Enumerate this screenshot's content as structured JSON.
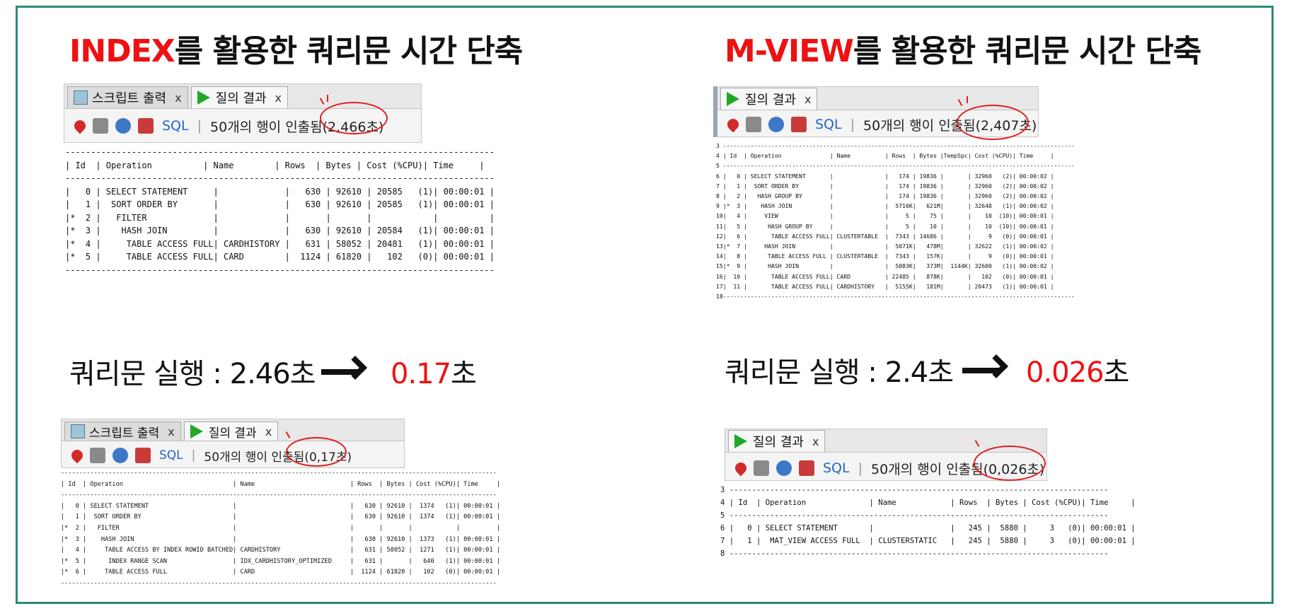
{
  "left": {
    "heading_red": "INDEX",
    "heading_rest": "를 활용한 쿼리문 시간 단축",
    "compare_label": "쿼리문 실행 : 2.46초",
    "compare_result_red": "0.17",
    "compare_result_unit": "초",
    "before_panel": {
      "tabs": [
        {
          "label": "스크립트 출력",
          "close": "x",
          "icon": "script-icon"
        },
        {
          "label": "질의 결과",
          "close": "x",
          "icon": "play-icon"
        }
      ],
      "toolbar_sql": "SQL",
      "status": "50개의 행이 인출됨(2,466초)"
    },
    "before_plan": "------------------------------------------------------------------------------------\n| Id  | Operation          | Name        | Rows  | Bytes | Cost (%CPU)| Time     |\n------------------------------------------------------------------------------------\n|   0 | SELECT STATEMENT     |             |   630 | 92610 | 20585   (1)| 00:00:01 |\n|   1 |  SORT ORDER BY       |             |   630 | 92610 | 20585   (1)| 00:00:01 |\n|*  2 |   FILTER             |             |       |       |            |          |\n|*  3 |    HASH JOIN         |             |   630 | 92610 | 20584   (1)| 00:00:01 |\n|*  4 |     TABLE ACCESS FULL| CARDHISTORY |   631 | 58052 | 20481   (1)| 00:00:01 |\n|*  5 |     TABLE ACCESS FULL| CARD        |  1124 | 61820 |   102   (0)| 00:00:01 |\n------------------------------------------------------------------------------------",
    "after_panel": {
      "tabs": [
        {
          "label": "스크립트 출력",
          "close": "x",
          "icon": "script-icon"
        },
        {
          "label": "질의 결과",
          "close": "x",
          "icon": "play-icon"
        }
      ],
      "toolbar_sql": "SQL",
      "status": "50개의 행이 인출됨(0,17초)"
    },
    "after_plan": "-----------------------------------------------------------------------------------------------------------------------\n| Id  | Operation                              | Name                          | Rows  | Bytes | Cost (%CPU)| Time     |\n-----------------------------------------------------------------------------------------------------------------------\n|   0 | SELECT STATEMENT                       |                               |   630 | 92610 |  1374   (1)| 00:00:01 |\n|   1 |  SORT ORDER BY                         |                               |   630 | 92610 |  1374   (1)| 00:00:01 |\n|*  2 |   FILTER                               |                               |       |       |            |          |\n|*  3 |    HASH JOIN                           |                               |   630 | 92610 |  1373   (1)| 00:00:01 |\n|   4 |     TABLE ACCESS BY INDEX ROWID BATCHED| CARDHISTORY                   |   631 | 58052 |  1271   (1)| 00:00:01 |\n|*  5 |      INDEX RANGE SCAN                  | IDX_CARDHISTORY_OPTIMIZED     |   631 |       |   640   (1)| 00:00:01 |\n|*  6 |     TABLE ACCESS FULL                  | CARD                          |  1124 | 61820 |   102   (0)| 00:00:01 |\n-----------------------------------------------------------------------------------------------------------------------"
  },
  "right": {
    "heading_red": "M-VIEW",
    "heading_rest": "를 활용한 쿼리문 시간 단축",
    "compare_label": "쿼리문 실행 : 2.4초",
    "compare_result_red": "0.026",
    "compare_result_unit": "초",
    "before_panel": {
      "tabs": [
        {
          "label": "질의 결과",
          "close": "x",
          "icon": "play-icon"
        }
      ],
      "toolbar_sql": "SQL",
      "status": "50개의 행이 인출됨(2,407초)"
    },
    "before_plan": "3 ------------------------------------------------------------------------------------------------------\n4 | Id  | Operation              | Name          | Rows  | Bytes |TempSpc| Cost (%CPU)| Time     |\n5 ------------------------------------------------------------------------------------------------------\n6 |   0 | SELECT STATEMENT       |               |   174 | 19836 |       | 32960   (2)| 00:00:02 |\n7 |   1 |  SORT ORDER BY         |               |   174 | 19836 |       | 32960   (2)| 00:00:02 |\n8 |   2 |   HASH GROUP BY        |               |   174 | 19836 |       | 32960   (2)| 00:00:02 |\n9 |*  3 |    HASH JOIN           |               |  5716K|   621M|       | 32648   (1)| 00:00:02 |\n10|   4 |     VIEW               |               |     5 |    75 |       |    10  (10)| 00:00:01 |\n11|   5 |      HASH GROUP BY     |               |     5 |    10 |       |    10  (10)| 00:00:01 |\n12|   6 |       TABLE ACCESS FULL| CLUSTERTABLE  |  7343 | 14686 |       |     9   (0)| 00:00:01 |\n13|*  7 |     HASH JOIN          |               |  5071K|   478M|       | 32622   (1)| 00:00:02 |\n14|   8 |      TABLE ACCESS FULL | CLUSTERTABLE  |  7343 |   157K|       |     9   (0)| 00:00:01 |\n15|*  9 |      HASH JOIN         |               |  5083K|   373M|  1144K| 32600   (1)| 00:00:02 |\n16|  10 |       TABLE ACCESS FULL| CARD          | 22485 |   878K|       |   102   (0)| 00:00:01 |\n17|  11 |       TABLE ACCESS FULL| CARDHISTORY   |  5155K|   181M|       | 20473   (1)| 00:00:01 |\n18------------------------------------------------------------------------------------------------------",
    "after_panel": {
      "tabs": [
        {
          "label": "질의 결과",
          "close": "x",
          "icon": "play-icon"
        }
      ],
      "toolbar_sql": "SQL",
      "status": "50개의 행이 인출됨(0,026초)"
    },
    "after_plan": "3 ------------------------------------------------------------------------------------\n4 | Id  | Operation              | Name            | Rows  | Bytes | Cost (%CPU)| Time     |\n5 ------------------------------------------------------------------------------------\n6 |   0 | SELECT STATEMENT       |                 |   245 |  5880 |     3   (0)| 00:00:01 |\n7 |   1 |  MAT_VIEW ACCESS FULL  | CLUSTERSTATIC   |   245 |  5880 |     3   (0)| 00:00:01 |\n8 ------------------------------------------------------------------------------------"
  },
  "colors": {
    "accent_red": "#ee1111",
    "frame": "#2f8878",
    "play_green": "#21a82b",
    "sql_blue": "#2266cc"
  }
}
